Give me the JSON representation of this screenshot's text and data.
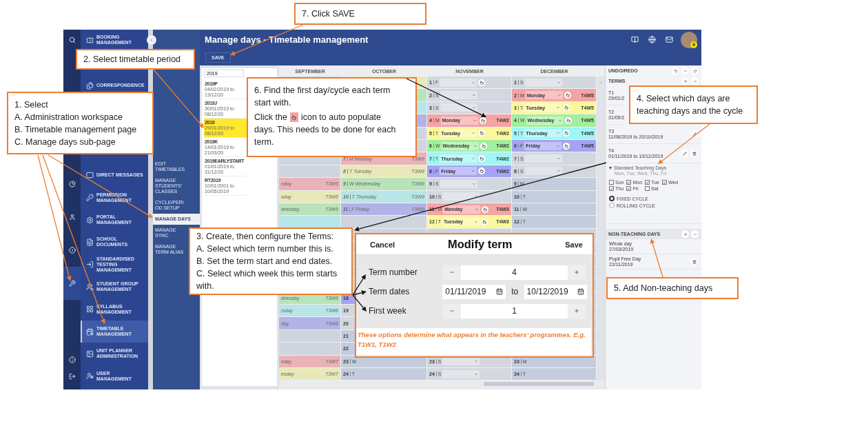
{
  "rail": {
    "items": [
      {
        "selected": false
      },
      {
        "selected": false
      },
      {
        "selected": false
      },
      {
        "selected": false
      },
      {
        "selected": true
      },
      {
        "selected": false
      },
      {
        "selected": false
      }
    ]
  },
  "nav": {
    "items": [
      {
        "label": "BOOKING MANAGEMENT",
        "selected": false
      },
      {
        "label": "CORRESPONDENCE",
        "selected": false
      },
      {
        "label": "DIRECT MESSAGES",
        "selected": false
      },
      {
        "label": "PERMISSION MANAGEMENT",
        "selected": false
      },
      {
        "label": "PORTAL MANAGEMENT",
        "selected": false
      },
      {
        "label": "SCHOOL DOCUMENTS",
        "selected": false
      },
      {
        "label": "STANDARDISED TESTING MANAGEMENT",
        "selected": false
      },
      {
        "label": "STUDENT GROUP MANAGEMENT",
        "selected": false
      },
      {
        "label": "SYLLABUS MANAGEMENT",
        "selected": false
      },
      {
        "label": "TIMETABLE MANAGEMENT",
        "selected": true
      },
      {
        "label": "UNIT PLANNER ADMINISTRATION",
        "selected": false
      },
      {
        "label": "USER MANAGEMENT",
        "selected": false
      }
    ]
  },
  "subnav": {
    "items": [
      {
        "label": "EDIT TIMETABLES",
        "selected": false
      },
      {
        "label": "MANAGE STUDENTS' CLASSES",
        "selected": false
      },
      {
        "label": "CYCLE/PERIOD SETUP",
        "selected": false
      },
      {
        "label": "MANAGE DAYS",
        "selected": true
      },
      {
        "label": "MANAGE SYNC",
        "selected": false
      },
      {
        "label": "MANAGE TERM ALIAS",
        "selected": false
      }
    ]
  },
  "header": {
    "title": "Manage days - Timetable management",
    "badge": "4"
  },
  "toolbar": {
    "save": "SAVE"
  },
  "periods": {
    "search": "2019",
    "items": [
      {
        "name": "2019P",
        "dates": "04/02/2019 to 13/12/20",
        "selected": false
      },
      {
        "name": "2019J",
        "dates": "30/01/2019 to 08/12/20",
        "selected": false
      },
      {
        "name": "2019",
        "dates": "29/01/2019 to 08/12/20",
        "selected": true
      },
      {
        "name": "2019K",
        "dates": "14/01/2019 to 21/03/20",
        "selected": false
      },
      {
        "name": "2019EARLYSTART",
        "dates": "01/01/2019 to 31/12/20",
        "selected": false
      },
      {
        "name": "RT2019",
        "dates": "10/01/2001 to 10/05/2019",
        "selected": false
      }
    ]
  },
  "calendar": {
    "months": [
      {
        "name": "SEPTEMBER",
        "cells": [
          {
            "kind": "blank"
          },
          {
            "kind": "blank"
          },
          {
            "kind": "blank"
          },
          {
            "kind": "blank"
          },
          {
            "kind": "blank"
          },
          {
            "kind": "blank"
          },
          {
            "kind": "blank",
            "color": "#cfd4dd"
          },
          {
            "kind": "blank",
            "color": "#cfd4dd"
          },
          {
            "kind": "past",
            "day": "nday",
            "week": "T3W5",
            "color": "#eab3b8"
          },
          {
            "kind": "past",
            "day": "sday",
            "week": "T3W5",
            "color": "#e9e8b9"
          },
          {
            "kind": "past",
            "day": "dnesday",
            "week": "T3W5",
            "color": "#b9e3b9"
          },
          {
            "kind": "blank",
            "color": "#b8e5e8"
          },
          {
            "kind": "blank"
          },
          {
            "kind": "blank"
          },
          {
            "kind": "blank"
          },
          {
            "kind": "blank"
          },
          {
            "kind": "blank"
          },
          {
            "kind": "past",
            "day": "dnesday",
            "week": "T3W6",
            "color": "#b9e3b9"
          },
          {
            "kind": "past",
            "day": "rsday",
            "week": "T3W6",
            "color": "#b8e5e8"
          },
          {
            "kind": "past",
            "day": "day",
            "week": "T3W6",
            "color": "#b3b3e8"
          },
          {
            "kind": "blank",
            "color": "#cfd4dd"
          },
          {
            "kind": "blank",
            "color": "#cfd4dd"
          },
          {
            "kind": "past",
            "day": "nday",
            "week": "T3W7",
            "color": "#eab3b8"
          },
          {
            "kind": "past",
            "day": "esday",
            "week": "T3W7",
            "color": "#e9e8b9"
          }
        ]
      },
      {
        "name": "OCTOBER",
        "cells": [
          {
            "kind": "blank",
            "color": "#e9e8b9"
          },
          {
            "kind": "blank",
            "color": "#b9e3b9"
          },
          {
            "kind": "blank",
            "color": "#b8e5e8"
          },
          {
            "kind": "blank",
            "color": "#b3b3e8"
          },
          {
            "kind": "blank",
            "color": "#cfd4dd"
          },
          {
            "kind": "blank",
            "color": "#cfd4dd"
          },
          {
            "kind": "past",
            "num": "7",
            "letter": "M",
            "day": "Monday",
            "week": "T3W9",
            "color": "#eab3b8"
          },
          {
            "kind": "past",
            "num": "8",
            "letter": "T",
            "day": "Tuesday",
            "week": "T3W9",
            "color": "#e9e8b9"
          },
          {
            "kind": "past",
            "num": "9",
            "letter": "W",
            "day": "Wednesday",
            "week": "T3W9",
            "color": "#b9e3b9"
          },
          {
            "kind": "past",
            "num": "10",
            "letter": "T",
            "day": "Thursday",
            "week": "T3W9",
            "color": "#b8e5e8"
          },
          {
            "kind": "past",
            "num": "11",
            "letter": "F",
            "day": "Friday",
            "week": "T3W9",
            "color": "#b3b3e8"
          },
          {
            "kind": "blank",
            "color": "#cfd4dd"
          },
          {
            "kind": "blank"
          },
          {
            "kind": "blank"
          },
          {
            "kind": "blank"
          },
          {
            "kind": "blank"
          },
          {
            "kind": "blank"
          },
          {
            "kind": "plain",
            "num": "18",
            "color": "#a4a4f4"
          },
          {
            "kind": "plain",
            "num": "19",
            "color": "#d3d7df"
          },
          {
            "kind": "plain",
            "num": "20",
            "color": "#d3d7df"
          },
          {
            "kind": "plain",
            "num": "21",
            "color": "#c3cddd"
          },
          {
            "kind": "plain",
            "num": "22",
            "color": "#c3cddd"
          },
          {
            "kind": "plain",
            "num": "23",
            "letter": "W",
            "color": "#c3cddd"
          },
          {
            "kind": "plain",
            "num": "24",
            "letter": "T",
            "color": "#c3cddd"
          }
        ]
      },
      {
        "name": "NOVEMBER",
        "cells": [
          {
            "kind": "select",
            "num": "1",
            "letter": "F",
            "auto": true,
            "color": "#d3d7df"
          },
          {
            "kind": "select",
            "num": "2",
            "letter": "S",
            "auto": false,
            "color": "#d3d7df"
          },
          {
            "kind": "select",
            "num": "3",
            "letter": "S",
            "auto": false,
            "color": "#d3d7df"
          },
          {
            "kind": "select",
            "num": "4",
            "letter": "M",
            "day": "Monday",
            "week": "T4W2",
            "auto": true,
            "color": "#f5a3a3"
          },
          {
            "kind": "select",
            "num": "5",
            "letter": "T",
            "day": "Tuesday",
            "week": "T4W2",
            "auto": true,
            "color": "#fbf79c"
          },
          {
            "kind": "select",
            "num": "6",
            "letter": "W",
            "day": "Wednesday",
            "week": "T4W2",
            "auto": true,
            "color": "#a2ef9e"
          },
          {
            "kind": "select",
            "num": "7",
            "letter": "T",
            "day": "Thursday",
            "week": "T4W2",
            "auto": true,
            "color": "#a0f5f5"
          },
          {
            "kind": "select",
            "num": "8",
            "letter": "F",
            "day": "Friday",
            "week": "T4W2",
            "auto": true,
            "color": "#a4a4f4"
          },
          {
            "kind": "select",
            "num": "9",
            "letter": "S",
            "auto": false,
            "color": "#d3d7df"
          },
          {
            "kind": "select",
            "num": "10",
            "letter": "S",
            "auto": false,
            "color": "#d3d7df"
          },
          {
            "kind": "select",
            "num": "11",
            "letter": "M",
            "day": "Monday",
            "week": "T4W3",
            "auto": true,
            "color": "#f5a3a3"
          },
          {
            "kind": "select",
            "num": "12",
            "letter": "T",
            "day": "Tuesday",
            "week": "T4W3",
            "auto": true,
            "color": "#fbf79c"
          },
          {
            "kind": "blank"
          },
          {
            "kind": "blank"
          },
          {
            "kind": "blank"
          },
          {
            "kind": "blank"
          },
          {
            "kind": "blank"
          },
          {
            "kind": "blank"
          },
          {
            "kind": "blank"
          },
          {
            "kind": "blank"
          },
          {
            "kind": "blank"
          },
          {
            "kind": "blank"
          },
          {
            "kind": "select",
            "num": "23",
            "letter": "S",
            "auto": false,
            "color": "#d3d7df"
          },
          {
            "kind": "select",
            "num": "24",
            "letter": "S",
            "auto": false,
            "color": "#d3d7df"
          }
        ]
      },
      {
        "name": "DECEMBER",
        "cells": [
          {
            "kind": "select",
            "num": "1",
            "letter": "S",
            "auto": false,
            "color": "#d3d7df"
          },
          {
            "kind": "select",
            "num": "2",
            "letter": "M",
            "day": "Monday",
            "week": "T4W5",
            "auto": true,
            "color": "#f5a3a3"
          },
          {
            "kind": "select",
            "num": "3",
            "letter": "T",
            "day": "Tuesday",
            "week": "T4W5",
            "auto": true,
            "color": "#fbf79c"
          },
          {
            "kind": "select",
            "num": "4",
            "letter": "W",
            "day": "Wednesday",
            "week": "T4W5",
            "auto": true,
            "color": "#a2ef9e"
          },
          {
            "kind": "select",
            "num": "5",
            "letter": "T",
            "day": "Thursday",
            "week": "T4W5",
            "auto": true,
            "color": "#a0f5f5"
          },
          {
            "kind": "select",
            "num": "6",
            "letter": "F",
            "day": "Friday",
            "week": "T4W5",
            "auto": true,
            "color": "#a4a4f4"
          },
          {
            "kind": "select",
            "num": "7",
            "letter": "S",
            "auto": false,
            "color": "#d3d7df"
          },
          {
            "kind": "select",
            "num": "8",
            "letter": "S",
            "auto": false,
            "color": "#d3d7df"
          },
          {
            "kind": "plain",
            "num": "9",
            "letter": "M",
            "color": "#c3cddd"
          },
          {
            "kind": "plain",
            "num": "10",
            "letter": "T",
            "color": "#c3cddd"
          },
          {
            "kind": "plain",
            "num": "11",
            "letter": "W",
            "color": "#c3cddd"
          },
          {
            "kind": "plain",
            "num": "12",
            "letter": "T",
            "color": "#c3cddd"
          },
          {
            "kind": "blank"
          },
          {
            "kind": "blank"
          },
          {
            "kind": "blank"
          },
          {
            "kind": "blank"
          },
          {
            "kind": "blank"
          },
          {
            "kind": "blank"
          },
          {
            "kind": "blank"
          },
          {
            "kind": "blank"
          },
          {
            "kind": "blank"
          },
          {
            "kind": "blank"
          },
          {
            "kind": "plain",
            "num": "23",
            "letter": "M",
            "color": "#c3cddd"
          },
          {
            "kind": "plain",
            "num": "24",
            "letter": "T",
            "color": "#c3cddd"
          }
        ]
      }
    ]
  },
  "side": {
    "undo_redo": "UNDO/REDO",
    "terms_title": "TERMS",
    "terms": [
      {
        "name": "T1",
        "dates": "29/01/2",
        "edit": false,
        "delete": false
      },
      {
        "name": "T2",
        "dates": "31/05/2",
        "edit": false,
        "delete": false
      },
      {
        "name": "T3",
        "dates": "11/08/2019 to 20/10/2019",
        "edit": true,
        "delete": false
      },
      {
        "name": "T4",
        "dates": "01/11/2019 to 10/12/2019",
        "edit": true,
        "delete": true
      }
    ],
    "teaching": {
      "title": "Standard Teaching Days",
      "summary": "Mon, Tue, Wed, Thu, Fri",
      "expanded": true,
      "days": [
        {
          "label": "Sun",
          "checked": false
        },
        {
          "label": "Mon",
          "checked": true
        },
        {
          "label": "Tue",
          "checked": true
        },
        {
          "label": "Wed",
          "checked": true
        },
        {
          "label": "Thu",
          "checked": true
        },
        {
          "label": "Fri",
          "checked": true
        },
        {
          "label": "Sat",
          "checked": false
        }
      ],
      "cycles": [
        {
          "label": "FIXED CYCLE",
          "selected": true
        },
        {
          "label": "ROLLING CYCLE",
          "selected": false
        }
      ]
    },
    "non_teaching_title": "NON-TEACHING DAYS",
    "non_teaching": [
      {
        "name": "Whole day",
        "date": "27/03/2019",
        "delete": false
      },
      {
        "name": "Pupil Free Day",
        "date": "22/11/2019",
        "delete": true
      }
    ]
  },
  "modal": {
    "cancel": "Cancel",
    "title": "Modify term",
    "save": "Save",
    "term_number": {
      "label": "Term number",
      "value": "4"
    },
    "term_dates": {
      "label": "Term dates",
      "start": "01/11/2019",
      "to": "to",
      "end": "10/12/2019"
    },
    "first_week": {
      "label": "First week",
      "value": "1"
    },
    "note": "These options determine what appears in the teachers’ programmes. E.g. T1W1, T1W2"
  },
  "callouts": [
    {
      "kind": "lines",
      "lines": [
        "7. Click SAVE"
      ]
    },
    {
      "kind": "lines",
      "lines": [
        "2. Select timetable period"
      ]
    },
    {
      "kind": "hint",
      "title": "6. Find the first day/cycle each term start with.",
      "before_icon": "Click the",
      "after_icon": "icon to auto populate",
      "rest": "days. This needs to be done for each term."
    },
    {
      "kind": "lines",
      "lines": [
        "4. Select which days are teaching days and the cycle"
      ]
    },
    {
      "kind": "lines",
      "lines": [
        "1. Select",
        "A. Administration workspace",
        "B. Timetable management page",
        "C. Manage days sub-page"
      ]
    },
    {
      "kind": "lines",
      "lines": [
        "3. Create, then configure the Terms:",
        "A. Select which term number this is.",
        "B. Set the term start and end dates.",
        "C. Select which week this term starts with."
      ]
    },
    {
      "kind": "lines",
      "lines": [
        "5. Add Non-teaching days"
      ]
    }
  ]
}
